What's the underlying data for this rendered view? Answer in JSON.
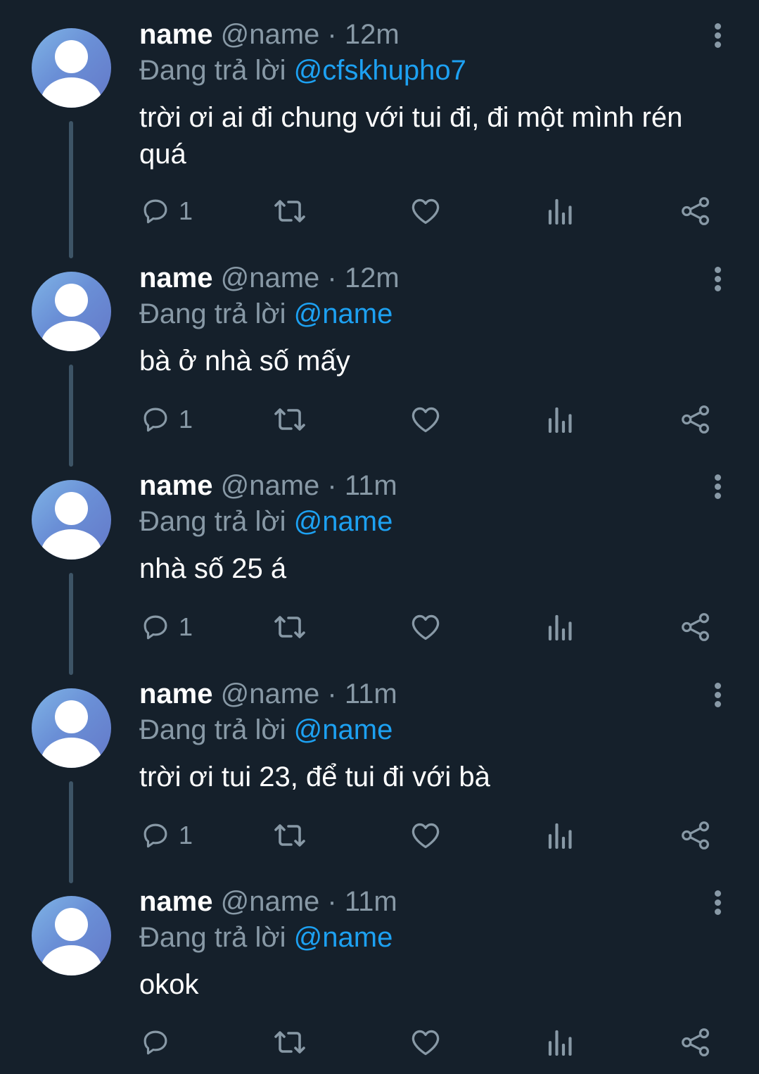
{
  "tweets": [
    {
      "name": "name",
      "handle": "@name",
      "time": "· 12m",
      "reply_prefix": "Đang trả lời",
      "reply_to": "@cfskhupho7",
      "text": "trời ơi ai đi chung với tui đi, đi một mình rén quá",
      "reply_count": "1"
    },
    {
      "name": "name",
      "handle": "@name",
      "time": "· 12m",
      "reply_prefix": "Đang trả lời",
      "reply_to": "@name",
      "text": "bà ở nhà số mấy",
      "reply_count": "1"
    },
    {
      "name": "name",
      "handle": "@name",
      "time": "· 11m",
      "reply_prefix": "Đang trả lời",
      "reply_to": "@name",
      "text": "nhà số 25 á",
      "reply_count": "1"
    },
    {
      "name": "name",
      "handle": "@name",
      "time": "· 11m",
      "reply_prefix": "Đang trả lời",
      "reply_to": "@name",
      "text": "trời ơi tui 23, để tui đi với bà",
      "reply_count": "1"
    },
    {
      "name": "name",
      "handle": "@name",
      "time": "· 11m",
      "reply_prefix": "Đang trả lời",
      "reply_to": "@name",
      "text": "okok",
      "reply_count": ""
    }
  ],
  "icons": {
    "reply": "reply-icon",
    "retweet": "retweet-icon",
    "like": "heart-icon",
    "analytics": "analytics-icon",
    "share": "share-icon",
    "more": "more-vertical-icon"
  },
  "colors": {
    "background": "#15202b",
    "muted_text": "#8899a6",
    "mention": "#1da1f2",
    "thread_line": "#3d5466"
  }
}
